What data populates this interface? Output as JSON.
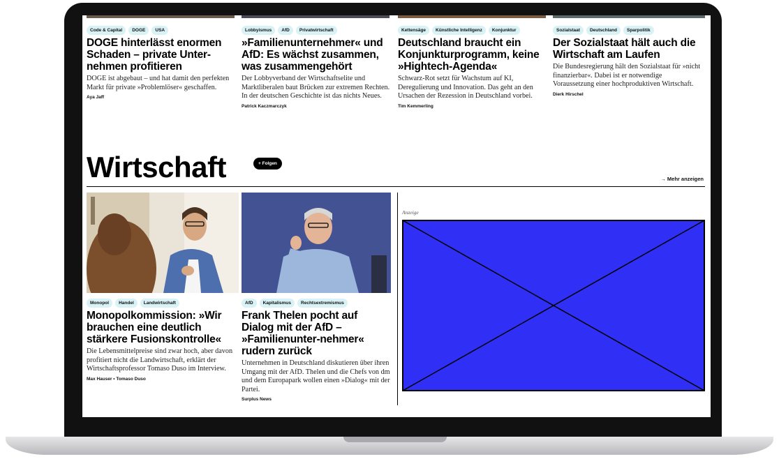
{
  "top_articles": [
    {
      "tags": [
        "Code & Capital",
        "DOGE",
        "USA"
      ],
      "headline": "DOGE hinterlässt enormen Schaden – private Unter-nehmen profitieren",
      "teaser": "DOGE ist abgebaut – und hat damit den perfekten Markt für private »Problemlöser« geschaffen.",
      "author": "Aya Jaff"
    },
    {
      "tags": [
        "Lobbyismus",
        "AfD",
        "Privatwirtschaft"
      ],
      "headline": "»Familienunternehmer« und AfD: Es wächst zusammen, was zusammengehört",
      "teaser": "Der Lobbyverband der Wirtschaftselite und Marktliberalen baut Brücken zur extremen Rechten. In der deutschen Geschichte ist das nichts Neues.",
      "author": "Patrick Kaczmarczyk"
    },
    {
      "tags": [
        "Kettensäge",
        "Künstliche Intelligenz",
        "Konjunktur"
      ],
      "headline": "Deutschland braucht ein Konjunkturprogramm, keine »Hightech-Agenda«",
      "teaser": "Schwarz-Rot setzt für Wachstum auf KI, Deregulierung und Innovation. Das geht an den Ursachen der Rezession in Deutschland vorbei.",
      "author": "Tim Kemmerling"
    },
    {
      "tags": [
        "Sozialstaat",
        "Deutschland",
        "Sparpolitik"
      ],
      "headline": "Der Sozialstaat hält auch die Wirtschaft am Laufen",
      "teaser": "Die Bundesregierung hält den Sozialstaat für »nicht finanzierbar«. Dabei ist er notwendige Voraussetzung einer hochproduktiven Wirtschaft.",
      "author": "Dierk Hirschel"
    }
  ],
  "section": {
    "title": "Wirtschaft",
    "follow_label": "+ Folgen",
    "more_label": "→ Mehr anzeigen"
  },
  "section_articles": [
    {
      "tags": [
        "Monopol",
        "Handel",
        "Landwirtschaft"
      ],
      "headline": "Monopolkommission: »Wir brauchen eine deutlich stärkere Fusionskontrolle«",
      "teaser": "Die Lebensmittelpreise sind zwar hoch, aber davon profitiert nicht die Landwirtschaft, erklärt der Wirtschaftsprofessor Tomaso Duso im Interview.",
      "author": "Max Hauser • Tomaso Duso",
      "image": "interview-photo"
    },
    {
      "tags": [
        "AfD",
        "Kapitalismus",
        "Rechtsextremismus"
      ],
      "headline": "Frank Thelen pocht auf Dialog mit der AfD – »Familienunter-nehmer« rudern zurück",
      "teaser": "Unternehmen in Deutschland diskutieren über ihren Umgang mit der AfD. Thelen und die Chefs von dm und dem Europapark wollen einen »Dialog« mit der Partei.",
      "author": "Surplus News",
      "image": "speaker-photo"
    }
  ],
  "ad": {
    "label": "Anzeige",
    "fill_color": "#2f2ff5"
  },
  "colors": {
    "tag_bg": "#d9f2f5",
    "follow_bg": "#000000",
    "bezel": "#111111"
  }
}
